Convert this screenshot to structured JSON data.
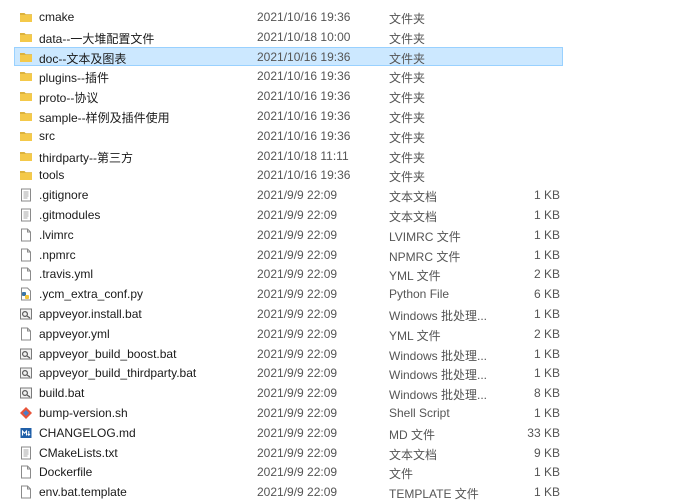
{
  "files": [
    {
      "name": "cmake",
      "date": "2021/10/16 19:36",
      "type": "文件夹",
      "size": "",
      "icon": "folder-icon"
    },
    {
      "name": "data--一大堆配置文件",
      "date": "2021/10/18 10:00",
      "type": "文件夹",
      "size": "",
      "icon": "folder-icon"
    },
    {
      "name": "doc--文本及图表",
      "date": "2021/10/16 19:36",
      "type": "文件夹",
      "size": "",
      "icon": "folder-icon",
      "selected": true
    },
    {
      "name": "plugins--插件",
      "date": "2021/10/16 19:36",
      "type": "文件夹",
      "size": "",
      "icon": "folder-icon"
    },
    {
      "name": "proto--协议",
      "date": "2021/10/16 19:36",
      "type": "文件夹",
      "size": "",
      "icon": "folder-icon"
    },
    {
      "name": "sample--样例及插件使用",
      "date": "2021/10/16 19:36",
      "type": "文件夹",
      "size": "",
      "icon": "folder-icon"
    },
    {
      "name": "src",
      "date": "2021/10/16 19:36",
      "type": "文件夹",
      "size": "",
      "icon": "folder-icon"
    },
    {
      "name": "thirdparty--第三方",
      "date": "2021/10/18 11:11",
      "type": "文件夹",
      "size": "",
      "icon": "folder-icon"
    },
    {
      "name": "tools",
      "date": "2021/10/16 19:36",
      "type": "文件夹",
      "size": "",
      "icon": "folder-icon"
    },
    {
      "name": ".gitignore",
      "date": "2021/9/9 22:09",
      "type": "文本文档",
      "size": "1 KB",
      "icon": "text-document-icon"
    },
    {
      "name": ".gitmodules",
      "date": "2021/9/9 22:09",
      "type": "文本文档",
      "size": "1 KB",
      "icon": "text-document-icon"
    },
    {
      "name": ".lvimrc",
      "date": "2021/9/9 22:09",
      "type": "LVIMRC 文件",
      "size": "1 KB",
      "icon": "blank-file-icon"
    },
    {
      "name": ".npmrc",
      "date": "2021/9/9 22:09",
      "type": "NPMRC 文件",
      "size": "1 KB",
      "icon": "blank-file-icon"
    },
    {
      "name": ".travis.yml",
      "date": "2021/9/9 22:09",
      "type": "YML 文件",
      "size": "2 KB",
      "icon": "blank-file-icon"
    },
    {
      "name": ".ycm_extra_conf.py",
      "date": "2021/9/9 22:09",
      "type": "Python File",
      "size": "6 KB",
      "icon": "python-file-icon"
    },
    {
      "name": "appveyor.install.bat",
      "date": "2021/9/9 22:09",
      "type": "Windows 批处理...",
      "size": "1 KB",
      "icon": "batch-file-icon"
    },
    {
      "name": "appveyor.yml",
      "date": "2021/9/9 22:09",
      "type": "YML 文件",
      "size": "2 KB",
      "icon": "blank-file-icon"
    },
    {
      "name": "appveyor_build_boost.bat",
      "date": "2021/9/9 22:09",
      "type": "Windows 批处理...",
      "size": "1 KB",
      "icon": "batch-file-icon"
    },
    {
      "name": "appveyor_build_thirdparty.bat",
      "date": "2021/9/9 22:09",
      "type": "Windows 批处理...",
      "size": "1 KB",
      "icon": "batch-file-icon"
    },
    {
      "name": "build.bat",
      "date": "2021/9/9 22:09",
      "type": "Windows 批处理...",
      "size": "8 KB",
      "icon": "batch-file-icon"
    },
    {
      "name": "bump-version.sh",
      "date": "2021/9/9 22:09",
      "type": "Shell Script",
      "size": "1 KB",
      "icon": "git-shell-icon"
    },
    {
      "name": "CHANGELOG.md",
      "date": "2021/9/9 22:09",
      "type": "MD 文件",
      "size": "33 KB",
      "icon": "markdown-file-icon"
    },
    {
      "name": "CMakeLists.txt",
      "date": "2021/9/9 22:09",
      "type": "文本文档",
      "size": "9 KB",
      "icon": "text-document-icon"
    },
    {
      "name": "Dockerfile",
      "date": "2021/9/9 22:09",
      "type": "文件",
      "size": "1 KB",
      "icon": "blank-file-icon"
    },
    {
      "name": "env.bat.template",
      "date": "2021/9/9 22:09",
      "type": "TEMPLATE 文件",
      "size": "1 KB",
      "icon": "blank-file-icon"
    }
  ]
}
